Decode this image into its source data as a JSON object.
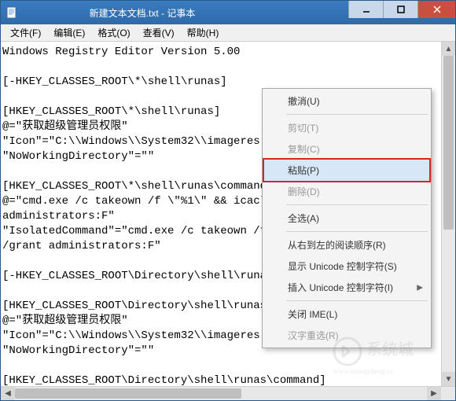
{
  "window": {
    "title": "新建文本文档.txt - 记事本"
  },
  "menubar": {
    "file": "文件(F)",
    "edit": "编辑(E)",
    "format": "格式(O)",
    "view": "查看(V)",
    "help": "帮助(H)"
  },
  "editor_text": "Windows Registry Editor Version 5.00\n\n[-HKEY_CLASSES_ROOT\\*\\shell\\runas]\n\n[HKEY_CLASSES_ROOT\\*\\shell\\runas]\n@=\"获取超级管理员权限\"\n\"Icon\"=\"C:\\\\Windows\\\\System32\\\\imageres.dll,-78\"\n\"NoWorkingDirectory\"=\"\"\n\n[HKEY_CLASSES_ROOT\\*\\shell\\runas\\command]\n@=\"cmd.exe /c takeown /f \\\"%1\\\" && icacls \\\"%1\\\" /grant\nadministrators:F\"\n\"IsolatedCommand\"=\"cmd.exe /c takeown /f \\\"%1\\\" && icacls \\\"%1\\\"\n/grant administrators:F\"\n\n[-HKEY_CLASSES_ROOT\\Directory\\shell\\runas]\n\n[HKEY_CLASSES_ROOT\\Directory\\shell\\runas]\n@=\"获取超级管理员权限\"\n\"Icon\"=\"C:\\\\Windows\\\\System32\\\\imageres.dll,-78\"\n\"NoWorkingDirectory\"=\"\"\n\n[HKEY_CLASSES_ROOT\\Directory\\shell\\runas\\command]\n@=\"cmd.exe /c takeown /f \\\"%1\\\" /r /d y && icacls \\\"%1\\\" /grant\nadministrators:F /t\"\n\"IsolatedCommand\"=\"cmd.exe /c takeown /f \\\n\"%1\\\" /grant administrators:F /t\"",
  "context_menu": {
    "undo": "撤消(U)",
    "cut": "剪切(T)",
    "copy": "复制(C)",
    "paste": "粘贴(P)",
    "delete": "删除(D)",
    "select_all": "全选(A)",
    "rtl_order": "从右到左的阅读顺序(R)",
    "show_unicode": "显示 Unicode 控制字符(S)",
    "insert_unicode": "插入 Unicode 控制字符(I)",
    "close_ime": "关闭 IME(L)",
    "hanzi_reselect": "汉字重选(R)"
  },
  "watermark": {
    "brand": "系统城",
    "url": "www.xitongcheng.cc"
  }
}
